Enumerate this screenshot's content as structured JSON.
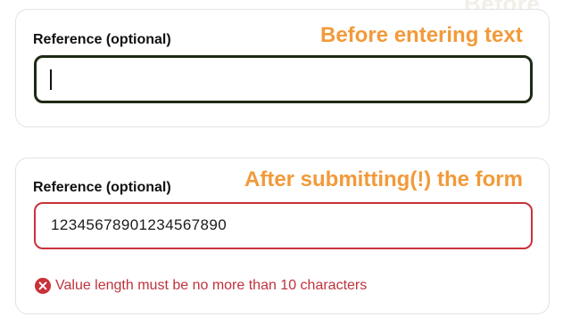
{
  "top_hint": "Before",
  "card_before": {
    "label": "Reference (optional)",
    "annotation": "Before entering text",
    "input": {
      "value": "",
      "state": "focused"
    }
  },
  "card_after": {
    "label": "Reference (optional)",
    "annotation": "After submitting(!) the form",
    "input": {
      "value": "12345678901234567890",
      "state": "error"
    },
    "error": {
      "icon": "error-circle-x-icon",
      "message": "Value length must be no more than 10 characters"
    }
  },
  "colors": {
    "annotation": "#f29a3a",
    "focus_border": "#1e2a14",
    "error": "#c8323a",
    "card_border": "#e2e2e2"
  }
}
